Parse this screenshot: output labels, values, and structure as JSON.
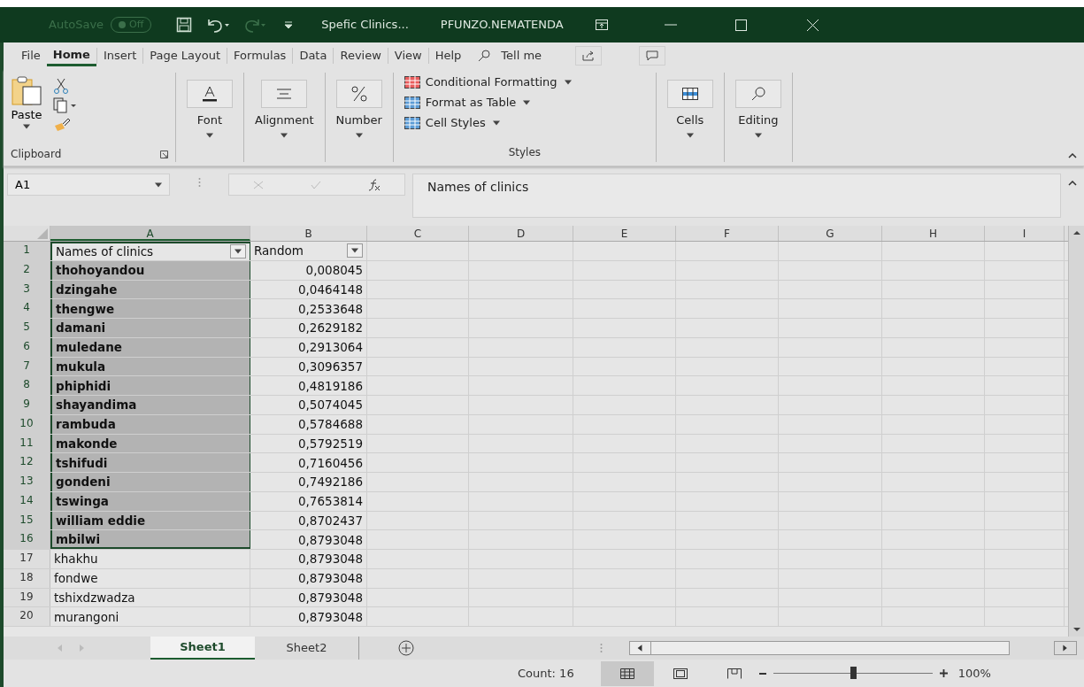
{
  "title_bar": {
    "autosave_label": "AutoSave",
    "autosave_state": "Off",
    "document": "Spefic Clinics...",
    "user": "PFUNZO.NEMATENDA"
  },
  "ribbon_tabs": [
    {
      "label": "File",
      "selected": false
    },
    {
      "label": "Home",
      "selected": true
    },
    {
      "label": "Insert",
      "selected": false
    },
    {
      "label": "Page Layout",
      "selected": false
    },
    {
      "label": "Formulas",
      "selected": false
    },
    {
      "label": "Data",
      "selected": false
    },
    {
      "label": "Review",
      "selected": false
    },
    {
      "label": "View",
      "selected": false
    },
    {
      "label": "Help",
      "selected": false
    }
  ],
  "tell_me": "Tell me",
  "ribbon": {
    "paste": "Paste",
    "clipboard": "Clipboard",
    "font": "Font",
    "alignment": "Alignment",
    "number": "Number",
    "styles_items": [
      "Conditional Formatting",
      "Format as Table",
      "Cell Styles"
    ],
    "styles": "Styles",
    "cells": "Cells",
    "editing": "Editing"
  },
  "formula_bar": {
    "name_box": "A1",
    "formula": "Names of clinics"
  },
  "columns": [
    {
      "label": "A",
      "selected": true
    },
    {
      "label": "B",
      "selected": false
    },
    {
      "label": "C",
      "selected": false
    },
    {
      "label": "D",
      "selected": false
    },
    {
      "label": "E",
      "selected": false
    },
    {
      "label": "F",
      "selected": false
    },
    {
      "label": "G",
      "selected": false
    },
    {
      "label": "H",
      "selected": false
    },
    {
      "label": "I",
      "selected": false
    }
  ],
  "rows": [
    {
      "number": "1",
      "name": "Names of clinics",
      "value": "Random",
      "selected": true,
      "kind": "header"
    },
    {
      "number": "2",
      "name": "thohoyandou",
      "value": "0,008045",
      "selected": true,
      "kind": "data"
    },
    {
      "number": "3",
      "name": "dzingahe",
      "value": "0,0464148",
      "selected": true,
      "kind": "data"
    },
    {
      "number": "4",
      "name": "thengwe",
      "value": "0,2533648",
      "selected": true,
      "kind": "data"
    },
    {
      "number": "5",
      "name": "damani",
      "value": "0,2629182",
      "selected": true,
      "kind": "data"
    },
    {
      "number": "6",
      "name": "muledane",
      "value": "0,2913064",
      "selected": true,
      "kind": "data"
    },
    {
      "number": "7",
      "name": "mukula",
      "value": "0,3096357",
      "selected": true,
      "kind": "data"
    },
    {
      "number": "8",
      "name": "phiphidi",
      "value": "0,4819186",
      "selected": true,
      "kind": "data"
    },
    {
      "number": "9",
      "name": "shayandima",
      "value": "0,5074045",
      "selected": true,
      "kind": "data"
    },
    {
      "number": "10",
      "name": "rambuda",
      "value": "0,5784688",
      "selected": true,
      "kind": "data"
    },
    {
      "number": "11",
      "name": "makonde",
      "value": "0,5792519",
      "selected": true,
      "kind": "data"
    },
    {
      "number": "12",
      "name": "tshifudi",
      "value": "0,7160456",
      "selected": true,
      "kind": "data"
    },
    {
      "number": "13",
      "name": "gondeni",
      "value": "0,7492186",
      "selected": true,
      "kind": "data"
    },
    {
      "number": "14",
      "name": "tswinga",
      "value": "0,7653814",
      "selected": true,
      "kind": "data"
    },
    {
      "number": "15",
      "name": "william eddie",
      "value": "0,8702437",
      "selected": true,
      "kind": "data"
    },
    {
      "number": "16",
      "name": "mbilwi",
      "value": "0,8793048",
      "selected": true,
      "kind": "data"
    },
    {
      "number": "17",
      "name": "khakhu",
      "value": "0,8793048",
      "selected": false,
      "kind": "data"
    },
    {
      "number": "18",
      "name": "fondwe",
      "value": "0,8793048",
      "selected": false,
      "kind": "data"
    },
    {
      "number": "19",
      "name": "tshixdzwadza",
      "value": "0,8793048",
      "selected": false,
      "kind": "data"
    },
    {
      "number": "20",
      "name": "murangoni",
      "value": "0,8793048",
      "selected": false,
      "kind": "data"
    }
  ],
  "sheet_tabs": [
    {
      "label": "Sheet1",
      "selected": true
    },
    {
      "label": "Sheet2",
      "selected": false
    }
  ],
  "status_bar": {
    "count": "Count: 16",
    "zoom": "100%",
    "zoom_slider": {
      "level": 0.5
    }
  }
}
